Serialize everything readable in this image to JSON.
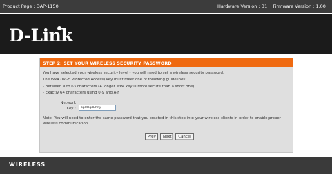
{
  "topbar": {
    "product": "Product Page : DAP-1150",
    "hardware": "Hardware Version : B1",
    "firmware": "Firmware Version : 1.00"
  },
  "logo": {
    "text": "D-Link"
  },
  "wizard": {
    "title": "STEP 2: SET YOUR WIRELESS SECURITY PASSWORD",
    "line1": "You have selected your wireless security level - you will need to set a wireless security password.",
    "line2": "The WPA (Wi-Fi Protected Access) key must meet one of following guidelines:",
    "line3": "- Between 8 to 63 characters (A longer WPA key is more secure than a short one)",
    "line4": "- Exactly 64 characters using 0-9 and A-F",
    "network_key_label": "Network Key :",
    "network_key_value": "bp8HqdLRny",
    "note": "Note: You will need to enter the same password that you created in this step into your wireless clients in order to enable proper wireless communication.",
    "prev_label": "Prev",
    "next_label": "Next",
    "cancel_label": "Cancel"
  },
  "footer": {
    "section": "WIRELESS"
  },
  "colors": {
    "header_orange": "#ef6a11",
    "panel_gray": "#dfdfdf",
    "dark_band": "#1b1b1b"
  }
}
